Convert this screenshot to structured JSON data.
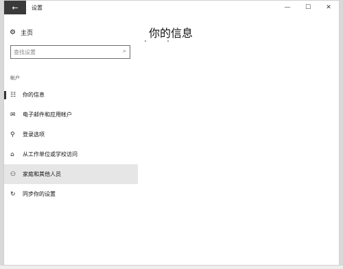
{
  "window": {
    "title": "设置",
    "back_icon": "←",
    "minimize_icon": "—",
    "maximize_icon": "☐",
    "close_icon": "✕"
  },
  "sidebar": {
    "home_label": "主页",
    "home_icon": "⚙",
    "search_placeholder": "查找设置",
    "search_icon": "⌕",
    "section_label": "帐户",
    "items": [
      {
        "label": "你的信息",
        "icon": "☷"
      },
      {
        "label": "电子邮件和应用帐户",
        "icon": "✉"
      },
      {
        "label": "登录选项",
        "icon": "⚲"
      },
      {
        "label": "从工作单位或学校访问",
        "icon": "⌂"
      },
      {
        "label": "家庭和其他人员",
        "icon": "⚇"
      },
      {
        "label": "同步你的设置",
        "icon": "↻"
      }
    ]
  },
  "main": {
    "title": "你的信息"
  }
}
